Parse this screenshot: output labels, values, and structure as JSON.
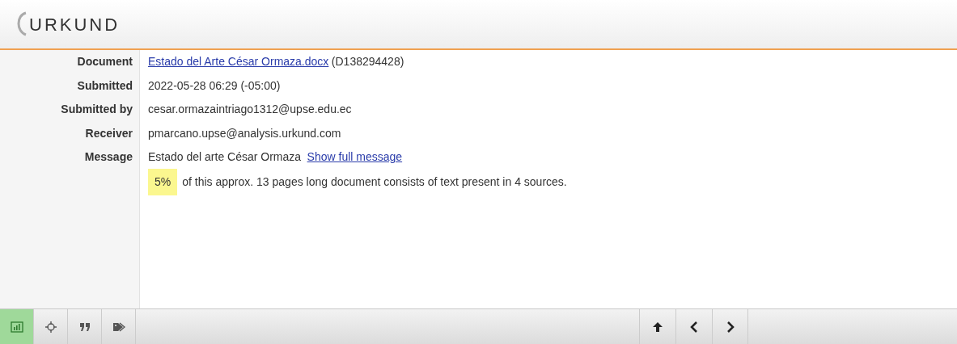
{
  "logo": "URKUND",
  "details": [
    {
      "label": "Document",
      "link": "Estado del Arte César Ormaza.docx",
      "suffix": "(D138294428)"
    },
    {
      "label": "Submitted",
      "value": "2022-05-28 06:29 (-05:00)"
    },
    {
      "label": "Submitted by",
      "value": "cesar.ormazaintriago1312@upse.edu.ec"
    },
    {
      "label": "Receiver",
      "value": "pmarcano.upse@analysis.urkund.com"
    },
    {
      "label": "Message",
      "value": "Estado del arte César Ormaza",
      "link": "Show full message"
    }
  ],
  "summary": {
    "percent": "5%",
    "text": "of this approx. 13 pages long document consists of text present in 4 sources."
  },
  "toolbar": {
    "tools": [
      {
        "kind": "chart",
        "selected": true
      },
      {
        "kind": "target",
        "selected": false
      },
      {
        "kind": "quote",
        "selected": false
      },
      {
        "kind": "tags",
        "selected": false
      }
    ],
    "navigation": [
      {
        "kind": "up"
      },
      {
        "kind": "prev"
      },
      {
        "kind": "next"
      }
    ]
  }
}
